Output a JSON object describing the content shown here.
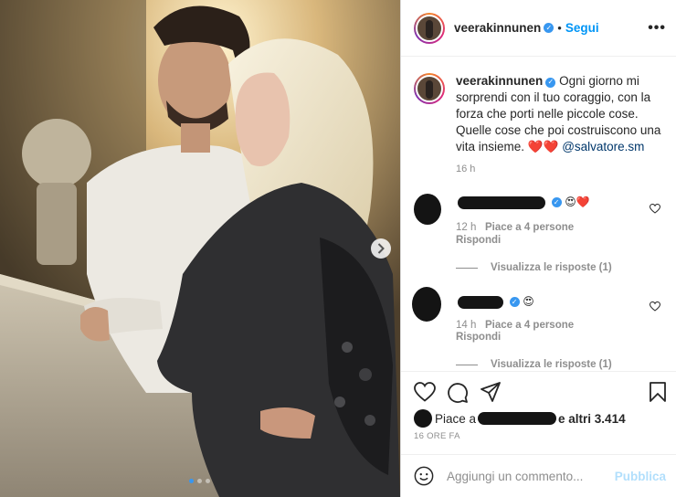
{
  "post": {
    "username": "veerakinnunen",
    "follow_label": "Segui",
    "separator": "•",
    "more_label": "•••",
    "carousel": {
      "slide_count": 3,
      "active_index": 0
    }
  },
  "caption": {
    "username": "veerakinnunen",
    "text": "Ogni giorno mi sorprendi con il tuo coraggio, con la forza che porti nelle piccole cose. Quelle cose che poi costruiscono una vita insieme.",
    "hearts": "❤️❤️",
    "mention": "@salvatore.sm",
    "time": "16 h"
  },
  "comments": [
    {
      "emoji": "😍❤️",
      "time": "12 h",
      "likes": "Piace a 4 persone",
      "reply_label": "Rispondi",
      "view_replies": "Visualizza le risposte (1)"
    },
    {
      "emoji": "😍",
      "time": "14 h",
      "likes": "Piace a 4 persone",
      "reply_label": "Rispondi",
      "view_replies": "Visualizza le risposte (1)"
    }
  ],
  "likes": {
    "prefix": "Piace a",
    "suffix": "e altri 3.414"
  },
  "timestamp": "16 ORE FA",
  "add_comment": {
    "placeholder": "Aggiungi un commento...",
    "publish_label": "Pubblica"
  },
  "colors": {
    "accent": "#0095f6",
    "verified": "#3897f0",
    "publish_disabled": "#b2dffc",
    "muted": "#8e8e8e"
  }
}
